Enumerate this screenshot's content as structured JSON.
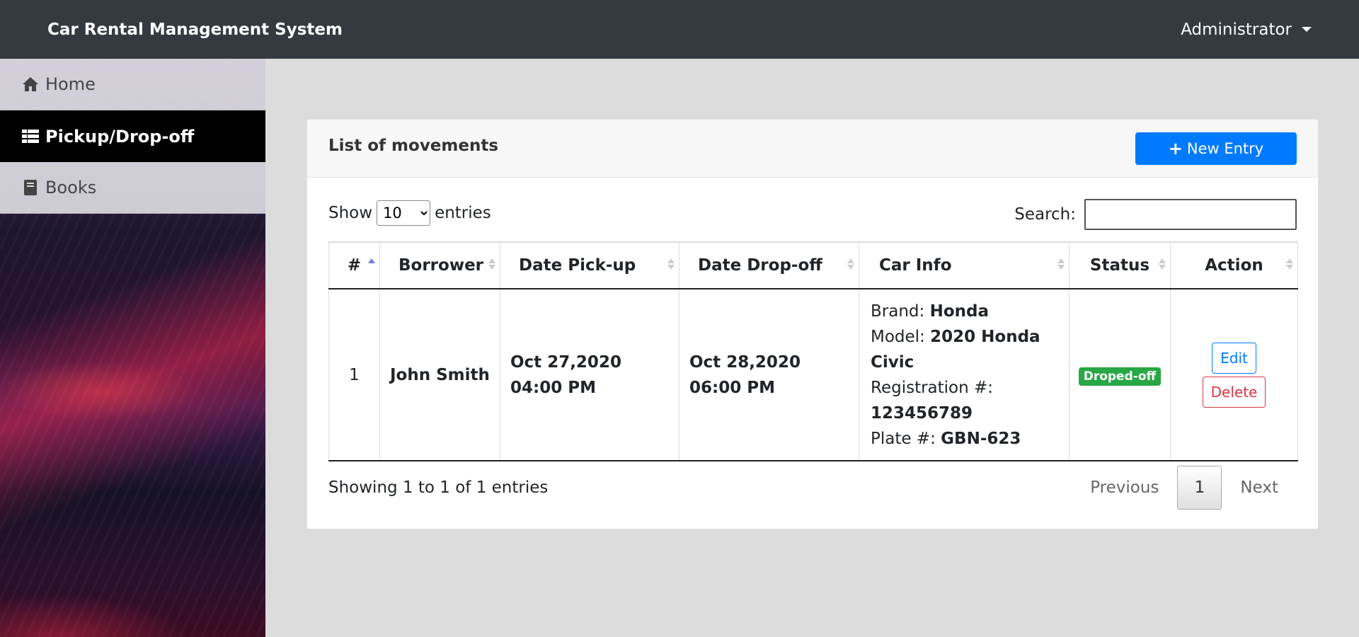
{
  "navbar": {
    "brand": "Car Rental Management System",
    "user": "Administrator"
  },
  "sidebar": {
    "items": [
      {
        "label": "Home",
        "icon": "home-icon"
      },
      {
        "label": "Pickup/Drop-off",
        "icon": "table-icon"
      },
      {
        "label": "Books",
        "icon": "book-icon"
      }
    ]
  },
  "card": {
    "title": "List of movements",
    "new_entry_label": "New Entry"
  },
  "controls": {
    "show_label": "Show",
    "entries_label": "entries",
    "length_value": "10",
    "search_label": "Search:",
    "search_value": ""
  },
  "table": {
    "headers": [
      "#",
      "Borrower",
      "Date Pick-up",
      "Date Drop-off",
      "Car Info",
      "Status",
      "Action"
    ],
    "rows": [
      {
        "num": "1",
        "borrower": "John Smith",
        "pickup": "Oct 27,2020 04:00 PM",
        "dropoff": "Oct 28,2020 06:00 PM",
        "brand_label": "Brand:",
        "brand": "Honda",
        "model_label": "Model:",
        "model": "2020 Honda Civic",
        "reg_label": "Registration #:",
        "reg": "123456789",
        "plate_label": "Plate #:",
        "plate": "GBN-623",
        "status": "Droped-off",
        "edit_label": "Edit",
        "delete_label": "Delete"
      }
    ]
  },
  "footer": {
    "info": "Showing 1 to 1 of 1 entries",
    "previous": "Previous",
    "page": "1",
    "next": "Next"
  },
  "colors": {
    "navbar": "#343a40",
    "primary": "#007bff",
    "success": "#28a745",
    "danger": "#dc3545"
  }
}
